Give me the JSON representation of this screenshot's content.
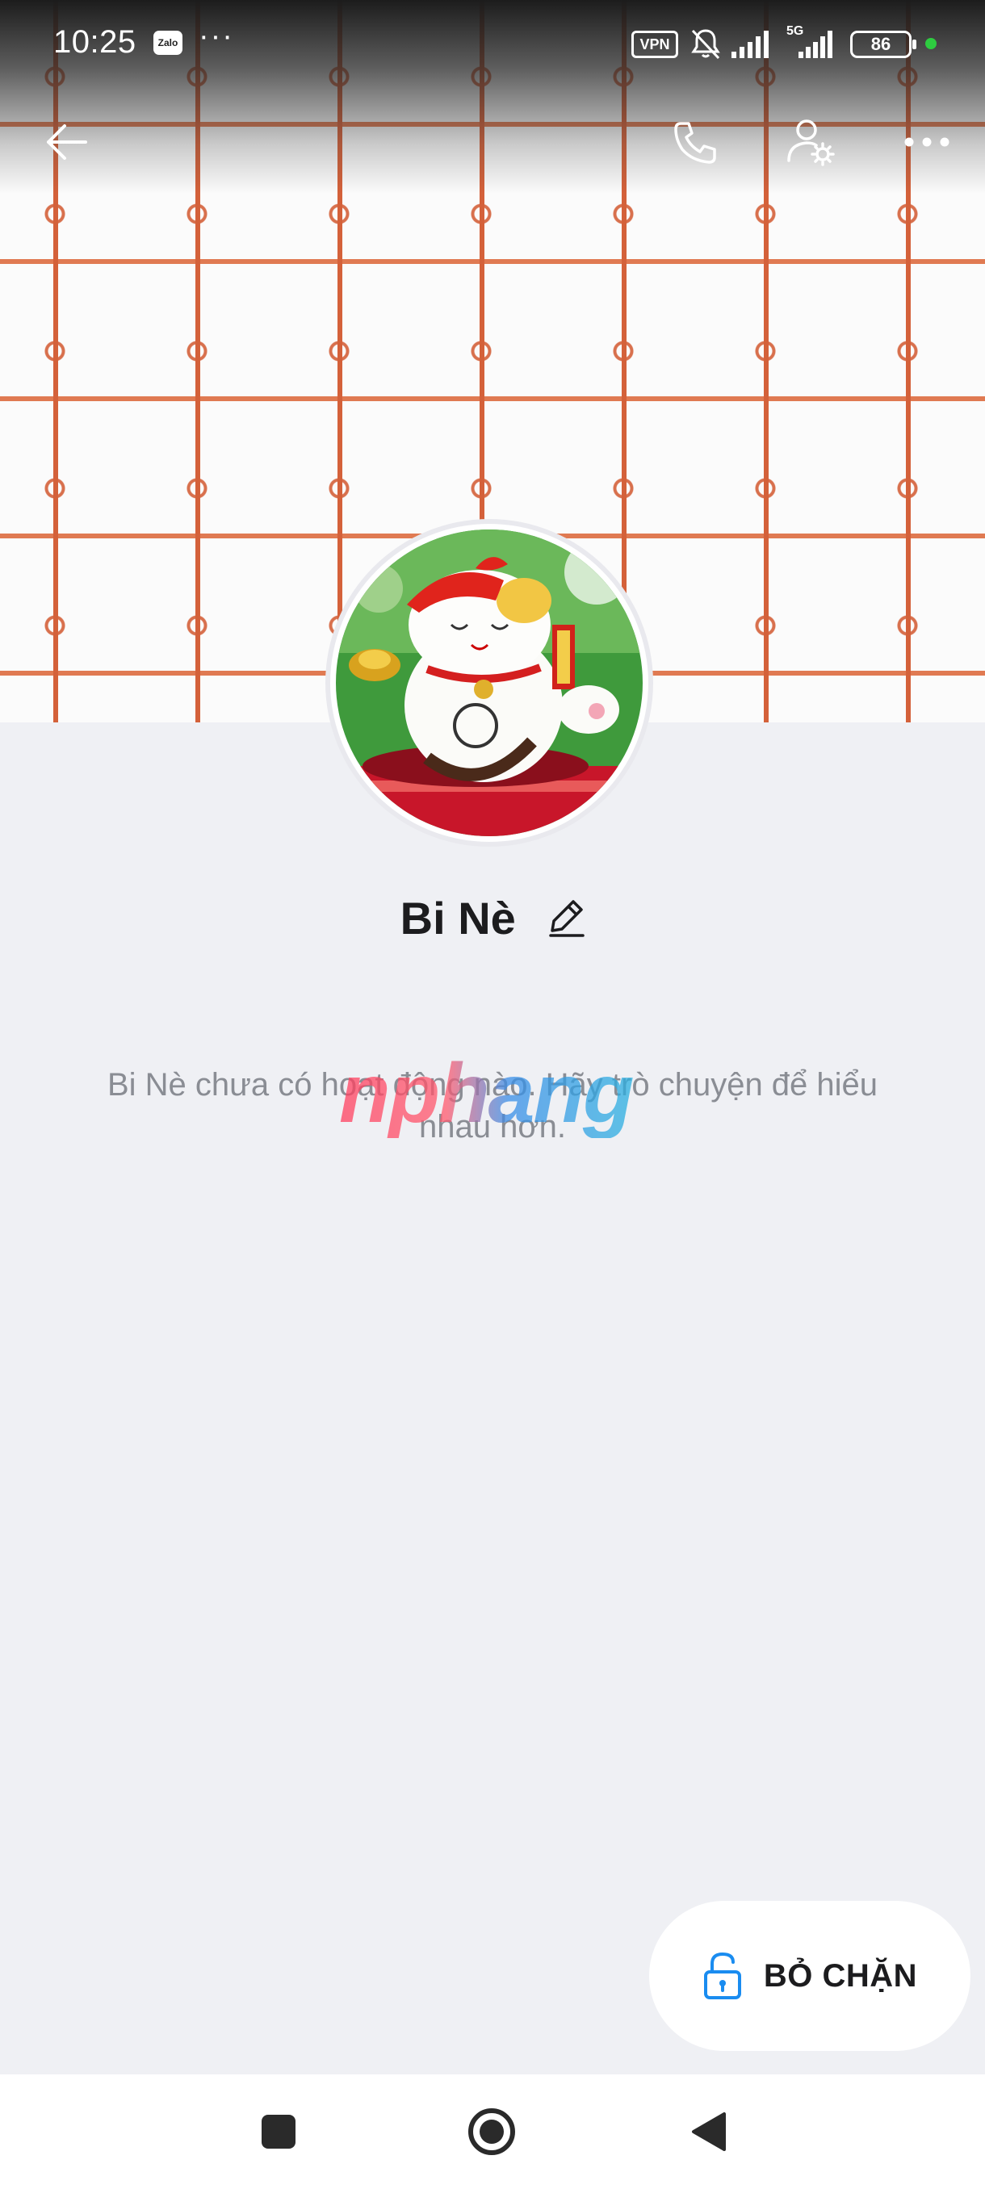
{
  "status_bar": {
    "time": "10:25",
    "app_badge": "Zalo",
    "more_dots": "···",
    "vpn": "VPN",
    "network": "5G",
    "battery": "86",
    "active_color": "#2ecc40"
  },
  "profile": {
    "name": "Bi Nè",
    "empty_message": "Bi Nè chưa có hoạt động nào. Hãy trò chuyện để hiểu nhau hơn."
  },
  "watermark": "nphang",
  "actions": {
    "unblock_label": "BỎ CHẶN",
    "accent_color": "#1a8cf0"
  },
  "icons": [
    "back-arrow-icon",
    "phone-icon",
    "user-settings-icon",
    "more-horizontal-icon",
    "edit-pencil-icon",
    "unlock-icon",
    "square-nav-icon",
    "home-circle-nav-icon",
    "back-triangle-nav-icon"
  ]
}
